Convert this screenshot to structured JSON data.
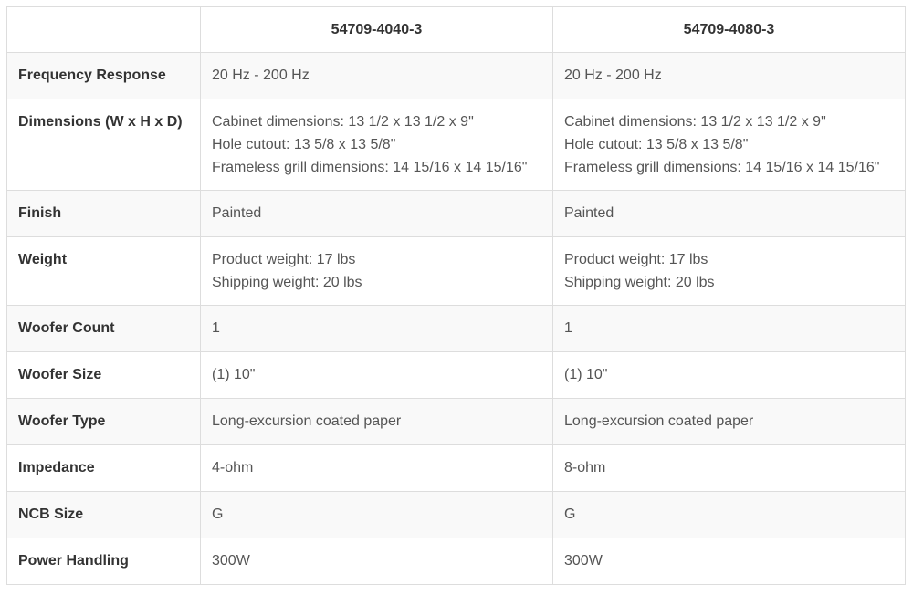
{
  "table": {
    "header": {
      "label": "",
      "product_a": "54709-4040-3",
      "product_b": "54709-4080-3"
    },
    "rows": [
      {
        "label": "Frequency Response",
        "a": [
          "20 Hz - 200 Hz"
        ],
        "b": [
          "20 Hz - 200 Hz"
        ]
      },
      {
        "label": "Dimensions (W x H x D)",
        "a": [
          "Cabinet dimensions: 13 1/2 x 13 1/2 x 9\"",
          "Hole cutout: 13 5/8 x 13 5/8\"",
          "Frameless grill dimensions: 14 15/16 x 14 15/16\""
        ],
        "b": [
          "Cabinet dimensions: 13 1/2 x 13 1/2 x 9\"",
          "Hole cutout: 13 5/8 x 13 5/8\"",
          "Frameless grill dimensions: 14 15/16 x 14 15/16\""
        ]
      },
      {
        "label": "Finish",
        "a": [
          "Painted"
        ],
        "b": [
          "Painted"
        ]
      },
      {
        "label": "Weight",
        "a": [
          "Product weight: 17 lbs",
          "Shipping weight: 20 lbs"
        ],
        "b": [
          "Product weight: 17 lbs",
          "Shipping weight: 20 lbs"
        ]
      },
      {
        "label": "Woofer Count",
        "a": [
          "1"
        ],
        "b": [
          "1"
        ]
      },
      {
        "label": "Woofer Size",
        "a": [
          "(1) 10\""
        ],
        "b": [
          "(1) 10\""
        ]
      },
      {
        "label": "Woofer Type",
        "a": [
          "Long-excursion coated paper"
        ],
        "b": [
          "Long-excursion coated paper"
        ]
      },
      {
        "label": "Impedance",
        "a": [
          "4-ohm"
        ],
        "b": [
          "8-ohm"
        ]
      },
      {
        "label": "NCB Size",
        "a": [
          "G"
        ],
        "b": [
          "G"
        ]
      },
      {
        "label": "Power Handling",
        "a": [
          "300W"
        ],
        "b": [
          "300W"
        ]
      }
    ]
  },
  "colors": {
    "border": "#dddddd",
    "row_alt": "#f9f9f9",
    "header_text": "#333333",
    "body_text": "#555555"
  }
}
